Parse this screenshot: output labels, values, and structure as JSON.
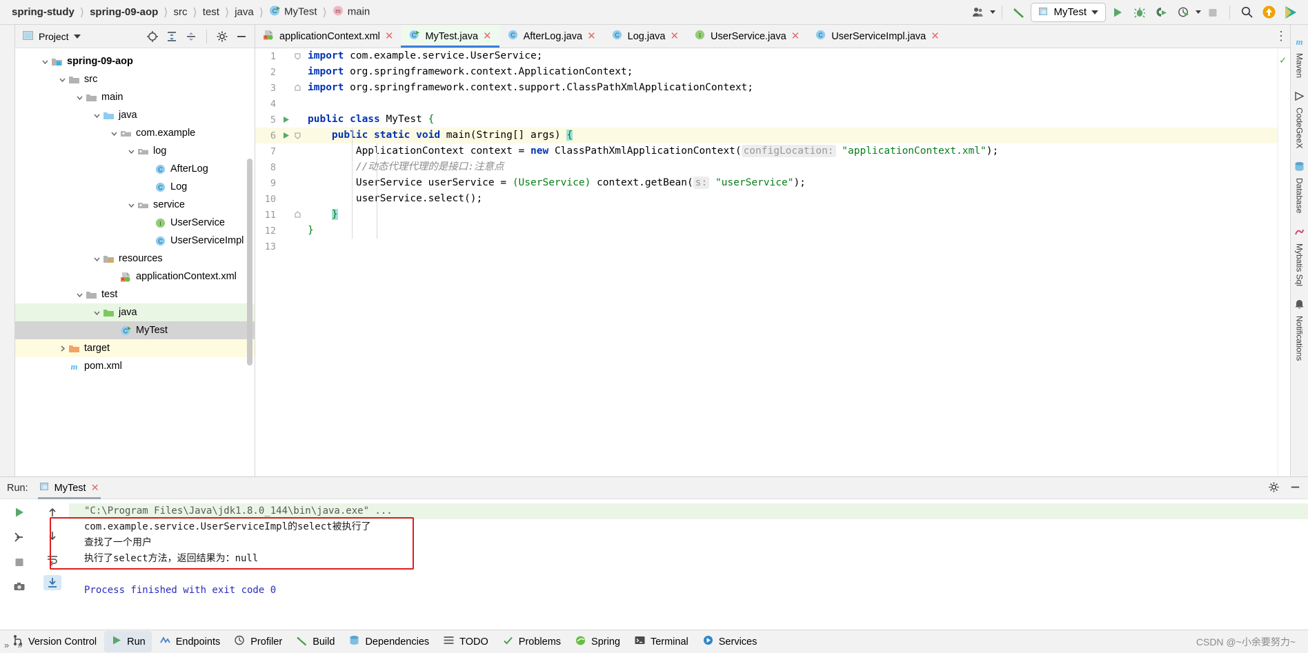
{
  "breadcrumb": {
    "items": [
      {
        "label": "spring-study",
        "bold": true,
        "icon": ""
      },
      {
        "label": "spring-09-aop",
        "bold": true,
        "icon": ""
      },
      {
        "label": "src",
        "bold": false,
        "icon": ""
      },
      {
        "label": "test",
        "bold": false,
        "icon": ""
      },
      {
        "label": "java",
        "bold": false,
        "icon": ""
      },
      {
        "label": "MyTest",
        "bold": false,
        "icon": "class-run-icon"
      },
      {
        "label": "main",
        "bold": false,
        "icon": "method-icon"
      }
    ],
    "separator": "〉"
  },
  "toolbar": {
    "account_icon": "account-icon",
    "build_icon": "build-hammer-icon",
    "run_config_name": "MyTest",
    "run_config_icon": "run-config-icon",
    "run_icon": "run-icon",
    "debug_icon": "debug-icon",
    "coverage_icon": "run-with-coverage-icon",
    "profiler_icon": "profiler-icon",
    "stop_icon": "stop-icon",
    "search_icon": "search-icon",
    "updates_icon": "updates-icon",
    "ide_icon": "ide-logo-icon"
  },
  "project_panel": {
    "title": "Project",
    "title_icon": "project-view-icon",
    "dropdown_icon": "chevron-down-icon",
    "actions": [
      {
        "name": "locate-icon"
      },
      {
        "name": "expand-all-icon"
      },
      {
        "name": "collapse-all-icon"
      },
      {
        "name": "settings-gear-icon"
      },
      {
        "name": "hide-icon"
      }
    ],
    "tree": [
      {
        "label": "spring-09-aop",
        "depth": 1,
        "arrow": "down",
        "icon": "module-folder-icon",
        "bold": true,
        "state": ""
      },
      {
        "label": "src",
        "depth": 2,
        "arrow": "down",
        "icon": "folder-icon",
        "bold": false,
        "state": ""
      },
      {
        "label": "main",
        "depth": 3,
        "arrow": "down",
        "icon": "folder-icon",
        "bold": false,
        "state": ""
      },
      {
        "label": "java",
        "depth": 4,
        "arrow": "down",
        "icon": "source-folder-icon",
        "bold": false,
        "state": ""
      },
      {
        "label": "com.example",
        "depth": 5,
        "arrow": "down",
        "icon": "package-icon",
        "bold": false,
        "state": ""
      },
      {
        "label": "log",
        "depth": 6,
        "arrow": "down",
        "icon": "package-icon",
        "bold": false,
        "state": ""
      },
      {
        "label": "AfterLog",
        "depth": 7,
        "arrow": "none",
        "icon": "class-icon",
        "bold": false,
        "state": ""
      },
      {
        "label": "Log",
        "depth": 7,
        "arrow": "none",
        "icon": "class-icon",
        "bold": false,
        "state": ""
      },
      {
        "label": "service",
        "depth": 6,
        "arrow": "down",
        "icon": "package-icon",
        "bold": false,
        "state": ""
      },
      {
        "label": "UserService",
        "depth": 7,
        "arrow": "none",
        "icon": "interface-icon",
        "bold": false,
        "state": ""
      },
      {
        "label": "UserServiceImpl",
        "depth": 7,
        "arrow": "none",
        "icon": "class-icon",
        "bold": false,
        "state": ""
      },
      {
        "label": "resources",
        "depth": 4,
        "arrow": "down",
        "icon": "resources-folder-icon",
        "bold": false,
        "state": ""
      },
      {
        "label": "applicationContext.xml",
        "depth": 5,
        "arrow": "none",
        "icon": "spring-xml-icon",
        "bold": false,
        "state": ""
      },
      {
        "label": "test",
        "depth": 3,
        "arrow": "down",
        "icon": "folder-icon",
        "bold": false,
        "state": ""
      },
      {
        "label": "java",
        "depth": 4,
        "arrow": "down",
        "icon": "test-source-folder-icon",
        "bold": false,
        "state": "green"
      },
      {
        "label": "MyTest",
        "depth": 5,
        "arrow": "none",
        "icon": "class-run-icon",
        "bold": false,
        "state": "grey"
      },
      {
        "label": "target",
        "depth": 2,
        "arrow": "right",
        "icon": "excluded-folder-icon",
        "bold": false,
        "state": "yellow"
      },
      {
        "label": "pom.xml",
        "depth": 2,
        "arrow": "none",
        "icon": "maven-icon",
        "bold": false,
        "state": ""
      }
    ]
  },
  "editor": {
    "tabs": [
      {
        "label": "applicationContext.xml",
        "icon": "spring-xml-icon",
        "active": false,
        "closable": true
      },
      {
        "label": "MyTest.java",
        "icon": "class-run-icon",
        "active": true,
        "closable": true
      },
      {
        "label": "AfterLog.java",
        "icon": "class-icon",
        "active": false,
        "closable": true
      },
      {
        "label": "Log.java",
        "icon": "class-icon",
        "active": false,
        "closable": true
      },
      {
        "label": "UserService.java",
        "icon": "interface-icon",
        "active": false,
        "closable": true
      },
      {
        "label": "UserServiceImpl.java",
        "icon": "class-icon",
        "active": false,
        "closable": true
      }
    ],
    "more_icon": "tabs-more-icon",
    "inspection_ok_icon": "inspection-ok-icon",
    "lines": [
      {
        "n": "1",
        "runnable": false,
        "fold": "top",
        "hl": false
      },
      {
        "n": "2",
        "runnable": false,
        "fold": "",
        "hl": false
      },
      {
        "n": "3",
        "runnable": false,
        "fold": "end",
        "hl": false
      },
      {
        "n": "4",
        "runnable": false,
        "fold": "",
        "hl": false
      },
      {
        "n": "5",
        "runnable": true,
        "fold": "",
        "hl": false
      },
      {
        "n": "6",
        "runnable": true,
        "fold": "top",
        "hl": true
      },
      {
        "n": "7",
        "runnable": false,
        "fold": "",
        "hl": false
      },
      {
        "n": "8",
        "runnable": false,
        "fold": "",
        "hl": false
      },
      {
        "n": "9",
        "runnable": false,
        "fold": "",
        "hl": false
      },
      {
        "n": "10",
        "runnable": false,
        "fold": "",
        "hl": false
      },
      {
        "n": "11",
        "runnable": false,
        "fold": "end",
        "hl": false
      },
      {
        "n": "12",
        "runnable": false,
        "fold": "",
        "hl": false
      },
      {
        "n": "13",
        "runnable": false,
        "fold": "",
        "hl": false
      }
    ],
    "code": {
      "l1_kw": "import",
      "l1_rest": " com.example.service.UserService;",
      "l2_kw": "import",
      "l2_rest": " org.springframework.context.ApplicationContext;",
      "l3_kw": "import",
      "l3_rest": " org.springframework.context.support.ClassPathXmlApplicationContext;",
      "l5_a": "public class",
      "l5_b": " MyTest ",
      "l5_c": "{",
      "l6_a": "public static void",
      "l6_b": " main",
      "l6_c": "(String[] args) ",
      "l6_d": "{",
      "l7_a": "ApplicationContext context = ",
      "l7_kw": "new",
      "l7_b": " ClassPathXmlApplicationContext(",
      "l7_hint": "configLocation:",
      "l7_str": "\"applicationContext.xml\"",
      "l7_c": ");",
      "l8_comment": "//动态代理代理的是接口:注意点",
      "l9_a": "UserService userService = ",
      "l9_cast": "(UserService)",
      "l9_b": " context.getBean(",
      "l9_hint": "s:",
      "l9_str": "\"userService\"",
      "l9_c": ");",
      "l10": "userService.select();",
      "l11": "}",
      "l12": "}"
    }
  },
  "right_strip": {
    "items": [
      {
        "label": "Maven",
        "icon": "maven-icon"
      },
      {
        "label": "CodeGeeX",
        "icon": "codegeex-icon"
      },
      {
        "label": "Database",
        "icon": "database-icon"
      },
      {
        "label": "Mybatis Sql",
        "icon": "mybatis-icon"
      },
      {
        "label": "Notifications",
        "icon": "notifications-icon"
      }
    ]
  },
  "run_panel": {
    "label": "Run:",
    "tab_label": "MyTest",
    "tab_icon": "run-config-icon",
    "tab_close_icon": "close-icon",
    "settings_icon": "settings-gear-icon",
    "minimize_icon": "minimize-icon",
    "left_tools": [
      {
        "name": "rerun-icon"
      },
      {
        "name": "stop-icon"
      },
      {
        "name": "pin-icon"
      },
      {
        "name": "camera-icon"
      }
    ],
    "mid_tools": [
      {
        "name": "scroll-up-icon"
      },
      {
        "name": "scroll-down-icon"
      },
      {
        "name": "soft-wrap-icon"
      },
      {
        "name": "scroll-to-end-icon"
      }
    ],
    "console_lines": [
      {
        "text": "\"C:\\Program Files\\Java\\jdk1.8.0_144\\bin\\java.exe\" ...",
        "style": "cmd"
      },
      {
        "text": "com.example.service.UserServiceImpl的select被执行了",
        "style": "out"
      },
      {
        "text": "查找了一个用户",
        "style": "out"
      },
      {
        "text": "执行了select方法，返回结果为：null",
        "style": "out"
      },
      {
        "text": "",
        "style": "out"
      },
      {
        "text": "Process finished with exit code 0",
        "style": "fin"
      }
    ],
    "highlight_color": "#e01b1b"
  },
  "status_bar": {
    "items": [
      {
        "label": "Version Control",
        "icon": "version-control-icon",
        "active": false
      },
      {
        "label": "Run",
        "icon": "run-icon",
        "active": true
      },
      {
        "label": "Endpoints",
        "icon": "endpoints-icon",
        "active": false
      },
      {
        "label": "Profiler",
        "icon": "profiler-icon",
        "active": false
      },
      {
        "label": "Build",
        "icon": "build-hammer-icon",
        "active": false
      },
      {
        "label": "Dependencies",
        "icon": "dependencies-icon",
        "active": false
      },
      {
        "label": "TODO",
        "icon": "todo-icon",
        "active": false
      },
      {
        "label": "Problems",
        "icon": "problems-icon",
        "active": false
      },
      {
        "label": "Spring",
        "icon": "spring-icon",
        "active": false
      },
      {
        "label": "Terminal",
        "icon": "terminal-icon",
        "active": false
      },
      {
        "label": "Services",
        "icon": "services-icon",
        "active": false
      }
    ],
    "watermark": "CSDN @~小余要努力~"
  },
  "colors": {
    "accent_blue": "#3c7ddb",
    "green": "#499c54",
    "keyword_blue": "#0033b3",
    "string_green": "#067d17",
    "red_box": "#e01b1b",
    "tab_active_bg": "#effaef"
  }
}
